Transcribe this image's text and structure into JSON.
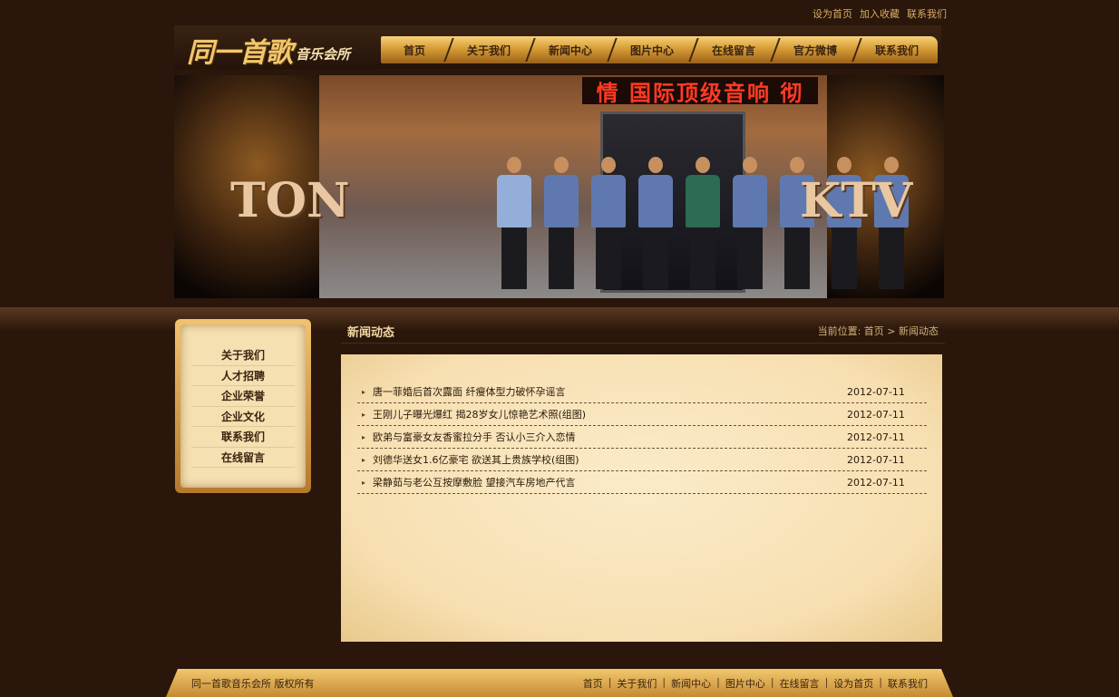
{
  "toplinks": [
    "设为首页",
    "加入收藏",
    "联系我们"
  ],
  "logo": {
    "main": "同一首歌",
    "sub": "音乐会所"
  },
  "nav": [
    "首页",
    "关于我们",
    "新闻中心",
    "图片中心",
    "在线留言",
    "官方微博",
    "联系我们"
  ],
  "banner": {
    "sign": "情 国际顶级音响 彻",
    "left_text": "TON",
    "right_text": "KTV"
  },
  "sidebar": [
    "关于我们",
    "人才招聘",
    "企业荣誉",
    "企业文化",
    "联系我们",
    "在线留言"
  ],
  "main": {
    "title": "新闻动态",
    "breadcrumb": "当前位置: 首页 > 新闻动态",
    "news": [
      {
        "title": "唐一菲婚后首次露面 纤瘦体型力破怀孕谣言",
        "date": "2012-07-11"
      },
      {
        "title": "王刚儿子曝光爆红 揭28岁女儿惊艳艺术照(组图)",
        "date": "2012-07-11"
      },
      {
        "title": "欧弟与富豪女友香蜜拉分手 否认小三介入恋情",
        "date": "2012-07-11"
      },
      {
        "title": "刘德华送女1.6亿豪宅 欲送其上贵族学校(组图)",
        "date": "2012-07-11"
      },
      {
        "title": "梁静茹与老公互按摩敷脸 望接汽车房地产代言",
        "date": "2012-07-11"
      }
    ]
  },
  "footer": {
    "copyright": "同一首歌音乐会所 版权所有",
    "links": [
      "首页",
      "关于我们",
      "新闻中心",
      "图片中心",
      "在线留言",
      "设为首页",
      "联系我们"
    ]
  },
  "colors": {
    "background": "#2a160a",
    "accent": "#e6a846",
    "panel": "#f7e2b5"
  }
}
